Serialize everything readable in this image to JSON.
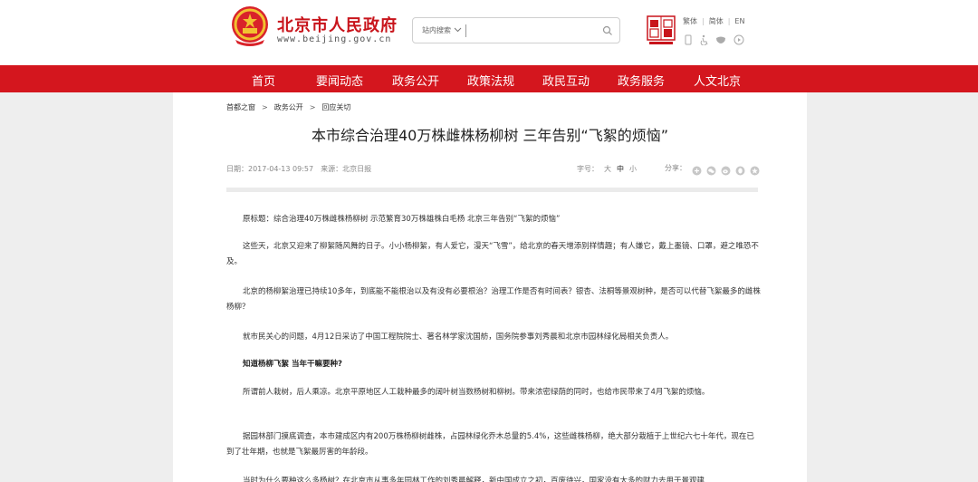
{
  "header": {
    "site_name": "北京市人民政府",
    "site_url": "www.beijing.gov.cn",
    "search_scope": "站内搜索",
    "search_value": "",
    "lang": [
      "繁体",
      "简体",
      "EN"
    ],
    "brand_red": "#c8141b"
  },
  "nav": {
    "items": [
      "首页",
      "要闻动态",
      "政务公开",
      "政策法规",
      "政民互动",
      "政务服务",
      "人文北京"
    ],
    "color": "#d4161e"
  },
  "breadcrumb": [
    "首都之窗",
    "政务公开",
    "回应关切"
  ],
  "article": {
    "title": "本市综合治理40万株雌株杨柳树 三年告别“飞絮的烦恼”",
    "date": "日期：2017-04-13 09:57",
    "source": "来源：北京日报",
    "font_size_label": "字号：",
    "font_sizes": [
      "大",
      "中",
      "小"
    ],
    "share_label": "分享：",
    "paragraphs": [
      "原标题：综合治理40万株雌株杨柳树 示范繁育30万株雄株白毛杨 北京三年告别“飞絮的烦恼”",
      "这些天，北京又迎来了柳絮随风舞的日子。小小杨柳絮，有人爱它，漫天“飞雪”，给北京的春天增添别样情趣；有人嫌它，戴上墨镜、口罩，避之唯恐不及。",
      "北京的杨柳絮治理已持续10多年，到底能不能根治以及有没有必要根治？治理工作是否有时间表？银杏、法桐等景观树种，是否可以代替飞絮最多的雌株杨柳？",
      "就市民关心的问题，4月12日采访了中国工程院院士、著名林学家沈国舫，国务院参事刘秀晨和北京市园林绿化局相关负责人。",
      "知道杨柳飞絮 当年干嘛要种?",
      "所谓前人栽树，后人乘凉。北京平原地区人工栽种最多的阔叶树当数杨树和柳树。带来浓密绿荫的同时，也给市民带来了4月飞絮的烦恼。",
      "据园林部门摸底调查，本市建成区内有200万株杨柳树雌株，占园林绿化乔木总量的5.4%，这些雌株杨柳，绝大部分栽植于上世纪六七十年代，现在已到了壮年期，也就是飞絮最厉害的年龄段。",
      "当时为什么要种这么多杨树？在北京市从事多年园林工作的刘秀晨解释，新中国成立之初，百废待兴，国家没有太多的财力去用于景观建"
    ]
  }
}
